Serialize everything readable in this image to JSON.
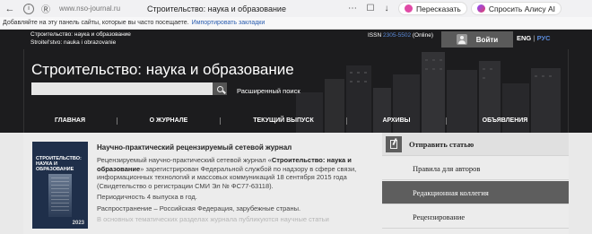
{
  "browser": {
    "url": "www.nso-journal.ru",
    "page_title": "Строительство: наука и образование",
    "retell_label": "Пересказать",
    "alice_label": "Спросить Алису AI"
  },
  "favorites_bar": {
    "hint": "Добавляйте на эту панель сайты, которые вы часто посещаете.",
    "import_link": "Импортировать закладки"
  },
  "header": {
    "site_name_ru": "Строительство: наука и образование",
    "site_name_en": "Stroitel'stvo: nauka i obrazovanie",
    "issn_label": "ISSN",
    "issn_number": "2305-5502",
    "issn_suffix": "(Online)",
    "login_label": "Войти",
    "lang_en": "ENG",
    "lang_sep": "|",
    "lang_ru": "РУС",
    "big_title": "Строительство: наука и образование",
    "search_placeholder": "",
    "advanced_search": "Расширенный поиск"
  },
  "nav": {
    "items": [
      {
        "label": "ГЛАВНАЯ"
      },
      {
        "label": "О ЖУРНАЛЕ"
      },
      {
        "label": "ТЕКУЩИЙ ВЫПУСК"
      },
      {
        "label": "АРХИВЫ"
      },
      {
        "label": "ОБЪЯВЛЕНИЯ"
      }
    ]
  },
  "cover": {
    "title_line1": "СТРОИТЕЛЬСТВО:",
    "title_line2": "НАУКА И ОБРАЗОВАНИЕ",
    "year": "2023"
  },
  "article": {
    "heading": "Научно-практический рецензируемый сетевой журнал",
    "p1_a": "Рецензируемый научно-практический сетевой журнал «",
    "p1_bold": "Строительство: наука и образование",
    "p1_b": "» зарегистрирован Федеральной службой по надзору в сфере связи, информационных технологий и массовых коммуникаций 18 сентября 2015 года (Свидетельство о регистрации СМИ Эл № ФС77-63118).",
    "p2": "Периодичность 4 выпуска в год.",
    "p3": "Распространение – Российская Федерация, зарубежные страны.",
    "p4_faded": "В основных тематических разделах журнала публикуются научные статьи"
  },
  "sidebar": {
    "items": [
      {
        "label": "Отправить статью"
      },
      {
        "label": "Правила для авторов"
      },
      {
        "label": "Редакционная коллегия"
      },
      {
        "label": "Рецензирование"
      }
    ]
  }
}
